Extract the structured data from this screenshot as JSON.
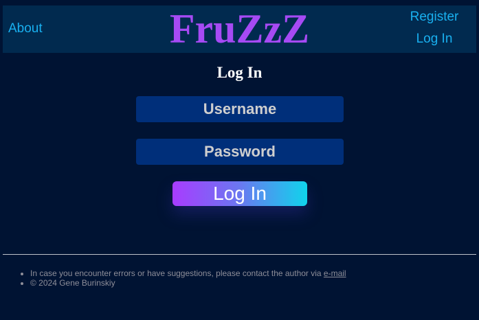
{
  "header": {
    "about_label": "About",
    "brand": "FruZzZ",
    "register_label": "Register",
    "login_label": "Log In"
  },
  "login": {
    "title": "Log In",
    "username_placeholder": "Username",
    "password_placeholder": "Password",
    "submit_label": "Log In"
  },
  "footer": {
    "contact_text": "In case you encounter errors or have suggestions, please contact the author via ",
    "contact_link": "e-mail",
    "copyright": "© 2024 Gene Burinskiy"
  },
  "colors": {
    "background": "#001333",
    "header": "#012a4f",
    "link": "#19b0f0",
    "brand": "#a64af4",
    "field": "#002f7a",
    "button_gradient_start": "#a83cff",
    "button_gradient_end": "#10d4ec"
  }
}
